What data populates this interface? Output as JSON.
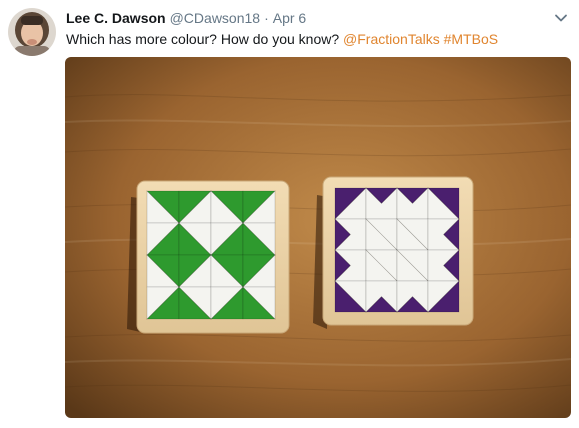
{
  "tweet": {
    "display_name": "Lee C. Dawson",
    "handle": "@CDawson18",
    "separator": "·",
    "date": "Apr 6",
    "text_prefix": "Which has more colour? How do you know? ",
    "mention": "@FractionTalks",
    "hashtag": "#MTBoS",
    "accent_color": "#e0852f",
    "icons": {
      "menu": "chevron-down-icon",
      "avatar": "avatar-photo"
    }
  },
  "media": {
    "puzzles": [
      {
        "color": "#2e9a2e",
        "name": "green-puzzle"
      },
      {
        "color": "#4a1f6e",
        "name": "purple-puzzle"
      }
    ]
  }
}
